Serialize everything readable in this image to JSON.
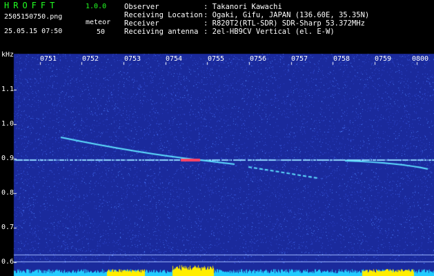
{
  "header": {
    "app_title": "HROFFT",
    "version": "1.0.0",
    "filename": "2505150750.png",
    "datetime": "25.05.15 07:50",
    "meteor_label": "meteor",
    "meteor_count": "50"
  },
  "station": [
    {
      "key": "Observer",
      "value": ": Takanori Kawachi"
    },
    {
      "key": "Receiving Location",
      "value": ": Ogaki, Gifu, JAPAN (136.60E, 35.35N)"
    },
    {
      "key": "Receiver",
      "value": ": R820T2(RTL-SDR) SDR-Sharp 53.372MHz"
    },
    {
      "key": "Receiving antenna",
      "value": ": 2el-HB9CV Vertical (el. E-W)"
    }
  ],
  "spectrogram": {
    "unit_label": "kHz",
    "y_ticks": [
      "1.1",
      "1.0",
      "0.9",
      "0.8",
      "0.7",
      "0.6"
    ],
    "x_ticks": [
      "0751",
      "0752",
      "0753",
      "0754",
      "0755",
      "0756",
      "0757",
      "0758",
      "0759",
      "0800"
    ],
    "colors": {
      "background": "#1a2a9c",
      "carrier": "#8fd6ff",
      "trace": "#5fe0ff",
      "hot": "#ff4466",
      "signal_bar": "#22ccff",
      "signal_peak": "#ffee00"
    }
  }
}
